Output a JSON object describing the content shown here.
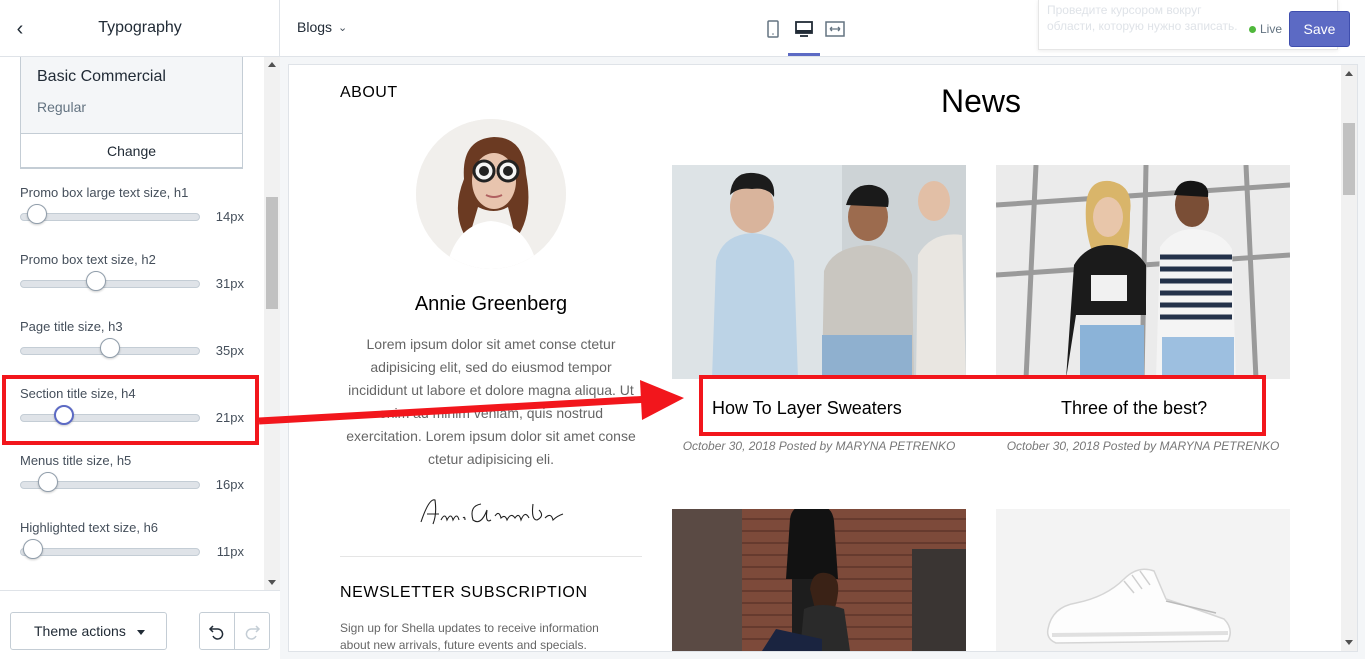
{
  "sidebar": {
    "title": "Typography",
    "font_card": {
      "name": "Basic Commercial",
      "style": "Regular",
      "change_label": "Change"
    },
    "settings": [
      {
        "label": "Promo box large text size, h1",
        "value": "14px",
        "level": 0.09
      },
      {
        "label": "Promo box text size, h2",
        "value": "31px",
        "level": 0.42
      },
      {
        "label": "Page title size, h3",
        "value": "35px",
        "level": 0.5
      },
      {
        "label": "Section title size, h4",
        "value": "21px",
        "level": 0.25
      },
      {
        "label": "Menus title size, h5",
        "value": "16px",
        "level": 0.16
      },
      {
        "label": "Highlighted text size, h6",
        "value": "11px",
        "level": 0.07
      }
    ],
    "footer": {
      "theme_actions_label": "Theme actions"
    }
  },
  "topbar": {
    "page_select": "Blogs",
    "ghost_text": "Проведите курсором вокруг области, которую нужно записать.",
    "live_label": "Live",
    "save_label": "Save"
  },
  "preview": {
    "about": {
      "heading": "ABOUT",
      "author_name": "Annie Greenberg",
      "bio": "Lorem ipsum dolor sit amet conse ctetur adipisicing elit, sed do eiusmod tempor incididunt ut labore et dolore magna aliqua. Ut enim ad minim veniam, quis nostrud exercitation. Lorem ipsum dolor sit amet conse ctetur adipisicing eli.",
      "signature": "Annie Greenberg"
    },
    "newsletter": {
      "heading": "NEWSLETTER SUBSCRIPTION",
      "text": "Sign up for Shella updates to receive information about new arrivals, future events and specials."
    },
    "news": {
      "heading": "News",
      "posts": [
        {
          "title": "How To Layer Sweaters",
          "meta": "October 30, 2018 Posted by MARYNA PETRENKO"
        },
        {
          "title": "Three of the best?",
          "meta": "October 30, 2018 Posted by MARYNA PETRENKO"
        }
      ]
    }
  },
  "colors": {
    "accent": "#5c6ac4",
    "annotation": "#f2161c",
    "live": "#50b83c"
  }
}
